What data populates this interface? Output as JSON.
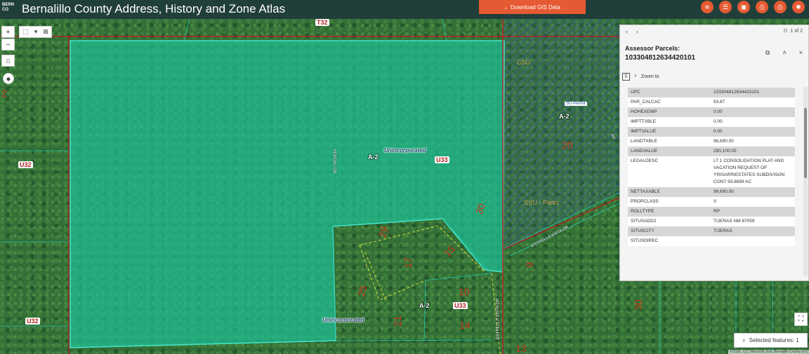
{
  "header": {
    "logo_text": "BERN CO",
    "title": "Bernalillo County Address, History and Zone Atlas",
    "download_label": "Download GIS Data",
    "accent": "#e55a32",
    "bar_color": "#213f3a",
    "icons": [
      "layers-icon",
      "list-icon",
      "save-icon",
      "print-icon",
      "print-icon",
      "settings-icon"
    ]
  },
  "map": {
    "labels": {
      "t32": "T32",
      "u32_left": "U32",
      "u32_bottom": "U32",
      "u33_center": "U33",
      "u33_bottom": "U33",
      "a2_center": "A-2",
      "a2_bottom": "A-2",
      "a2_right": "A-2",
      "uninc_center": "Unincorporated",
      "uninc_bottom": "Unincorporated",
      "csu_top": "CSU",
      "csu_lower": "CSU - Parks",
      "su_permit": "SU-Permit",
      "lot_20": "20",
      "lot_30a": "30",
      "lot_29": "29",
      "lot_15": "15",
      "lot_17": "17",
      "lot_25": "25",
      "lot_10": "10",
      "lot_21": "21",
      "lot_14": "14",
      "lot_9": "9",
      "lot_30b": "30",
      "lot_13": "13",
      "lot_2": "2",
      "road_verdad": "VERDAD DR",
      "road_estrella1": "ESTRELLA VISTA DR",
      "road_estrella2": "ESTRELLA VISTA DR",
      "road_ap": "AP"
    },
    "attribution": "VCGIS, CC, Microsoft, Esri, Bernalillo County GIS"
  },
  "controls": {
    "zoom_in": "+",
    "zoom_out": "−",
    "home": "⌂",
    "compass": "◆"
  },
  "popup": {
    "nav_prev": "‹",
    "nav_next": "›",
    "count": "1 of 2",
    "layer_title": "Assessor Parcels:",
    "feature_id": "103304812634420101",
    "zoom_to": "Zoom to",
    "attributes": [
      {
        "key": "UPC",
        "value": "103304812634420101"
      },
      {
        "key": "PAR_CALCAC",
        "value": "93.87"
      },
      {
        "key": "HOHEXEMP",
        "value": "0.00"
      },
      {
        "key": "IMPTTXBLE",
        "value": "0.00"
      },
      {
        "key": "IMPTVALUE",
        "value": "0.00"
      },
      {
        "key": "LANDTXBLE",
        "value": "96,690.00"
      },
      {
        "key": "LANDVALUE",
        "value": "290,100.00"
      },
      {
        "key": "LEGALDESC",
        "value": "LT 1 CONSOLIDATION PLAT AND VACATION REQUEST OF YRISARRIESTATES SUBDIVISON CONT 93.8699 AC"
      },
      {
        "key": "NETTAXABLE",
        "value": "96,690.00"
      },
      {
        "key": "PROPCLASS",
        "value": "V"
      },
      {
        "key": "ROLLTYPE",
        "value": "RP"
      },
      {
        "key": "SITUSADD2",
        "value": "TIJERAS NM 87059"
      },
      {
        "key": "SITUSCITY",
        "value": "TIJERAS"
      },
      {
        "key": "SITUSDIREC",
        "value": ""
      }
    ]
  },
  "selected_features": "Selected features: 1"
}
